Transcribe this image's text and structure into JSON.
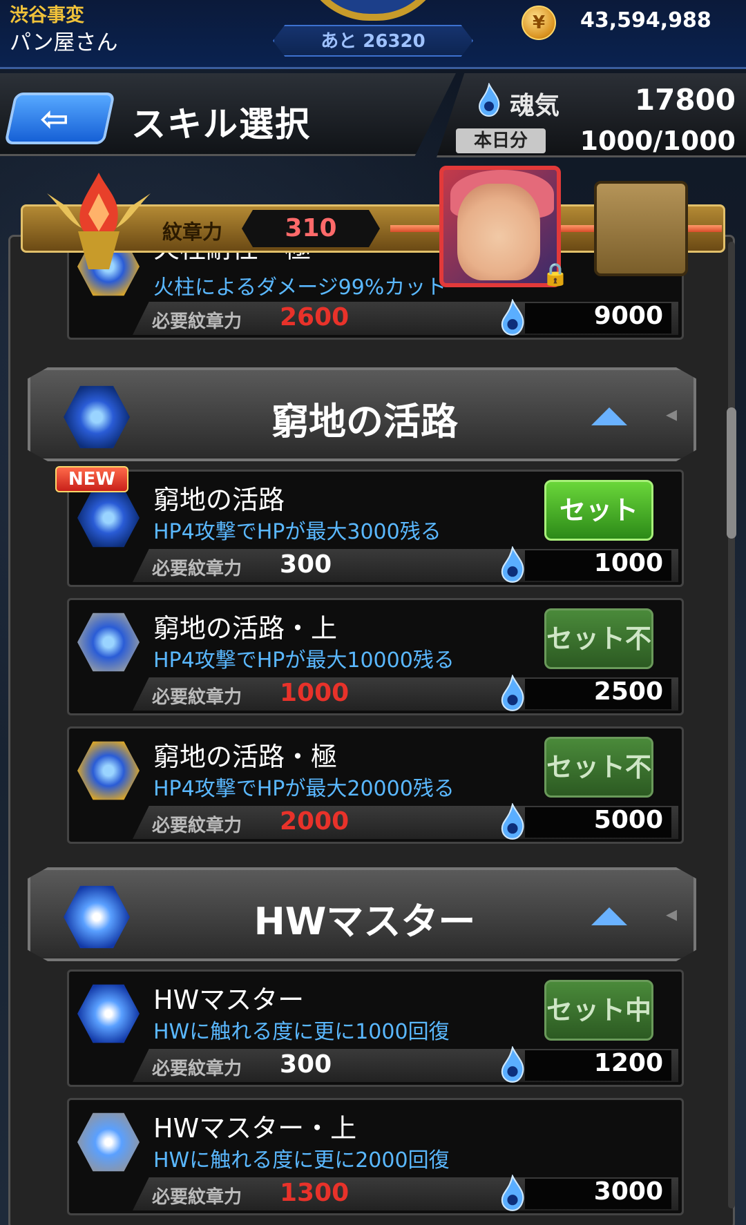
{
  "topbar": {
    "event_name": "渋谷事変",
    "player_name": "パン屋さん",
    "remaining": "あと 26320",
    "coin_value": "43,594,988"
  },
  "header": {
    "title": "スキル選択",
    "soul_label": "魂気",
    "soul_value": "17800",
    "today_label": "本日分",
    "today_value": "1000/1000"
  },
  "emblem": {
    "label": "紋章力",
    "value": "310"
  },
  "common": {
    "req_label": "必要紋章力",
    "set": "セット",
    "set_disabled": "セット不可",
    "set_active": "セット中",
    "new": "NEW"
  },
  "rows": {
    "partial": {
      "name": "火柱耐性・極",
      "desc": "火柱によるダメージ99%カット",
      "req": "2600",
      "cost": "9000"
    }
  },
  "sections": [
    {
      "title": "窮地の活路",
      "skills": [
        {
          "name": "窮地の活路",
          "desc": "HP4攻撃でHPが最大3000残る",
          "req": "300",
          "cost": "1000",
          "button": "セット"
        },
        {
          "name": "窮地の活路・上",
          "desc": "HP4攻撃でHPが最大10000残る",
          "req": "1000",
          "cost": "2500",
          "button": "セット不可"
        },
        {
          "name": "窮地の活路・極",
          "desc": "HP4攻撃でHPが最大20000残る",
          "req": "2000",
          "cost": "5000",
          "button": "セット不可"
        }
      ]
    },
    {
      "title": "HWマスター",
      "skills": [
        {
          "name": "HWマスター",
          "desc": "HWに触れる度に更に1000回復",
          "req": "300",
          "cost": "1200",
          "button": "セット中"
        },
        {
          "name": "HWマスター・上",
          "desc": "HWに触れる度に更に2000回復",
          "req": "1300",
          "cost": "3000"
        }
      ]
    }
  ],
  "icons": {
    "back": "left-arrow-icon",
    "coin": "coin-icon",
    "soul": "soul-flame-icon",
    "lock": "lock-icon"
  },
  "colors": {
    "accent_blue": "#5ab8ff",
    "required_red": "#e8322a",
    "button_green": "#2c8a18",
    "gold": "#f0c23a"
  }
}
